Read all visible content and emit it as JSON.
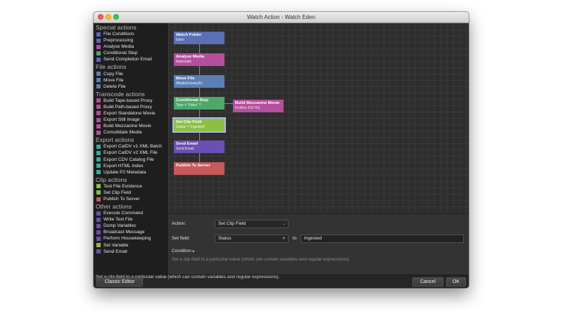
{
  "window": {
    "title": "Watch Action - Watch Eden"
  },
  "sidebar": {
    "sections": [
      {
        "title": "Special actions",
        "items": [
          {
            "label": "File Conditions",
            "color": "#5b67c8"
          },
          {
            "label": "Preprocessing",
            "color": "#5b67c8"
          },
          {
            "label": "Analyse Media",
            "color": "#b44f9e"
          },
          {
            "label": "Conditional Step",
            "color": "#4fa86a"
          },
          {
            "label": "Send Completion Email",
            "color": "#5b67c8"
          }
        ]
      },
      {
        "title": "File actions",
        "items": [
          {
            "label": "Copy File",
            "color": "#5b7fb5"
          },
          {
            "label": "Move File",
            "color": "#5b7fb5"
          },
          {
            "label": "Delete File",
            "color": "#5b7fb5"
          }
        ]
      },
      {
        "title": "Transcode actions",
        "items": [
          {
            "label": "Build Tape-based Proxy",
            "color": "#b44f9e"
          },
          {
            "label": "Build Path-based Proxy",
            "color": "#b44f9e"
          },
          {
            "label": "Export Standalone Movie",
            "color": "#b44f9e"
          },
          {
            "label": "Export Still Image",
            "color": "#b44f9e"
          },
          {
            "label": "Build Mezzanine Movie",
            "color": "#b44f9e"
          },
          {
            "label": "Consolidate Media",
            "color": "#b44f9e"
          }
        ]
      },
      {
        "title": "Export actions",
        "items": [
          {
            "label": "Export CatDV v1 XML Batch",
            "color": "#3fa7a0"
          },
          {
            "label": "Export CatDV v2 XML File",
            "color": "#3fa7a0"
          },
          {
            "label": "Export CDV Catalog File",
            "color": "#3fa7a0"
          },
          {
            "label": "Export HTML Index",
            "color": "#3fa7a0"
          },
          {
            "label": "Update P2 Metadata",
            "color": "#3fa7a0"
          }
        ]
      },
      {
        "title": "Clip actions",
        "items": [
          {
            "label": "Test File Existence",
            "color": "#8dbf45"
          },
          {
            "label": "Set Clip Field",
            "color": "#8dbf45"
          },
          {
            "label": "Publish To Server",
            "color": "#c75a5a"
          }
        ]
      },
      {
        "title": "Other actions",
        "items": [
          {
            "label": "Execute Command",
            "color": "#6a50b0"
          },
          {
            "label": "Write Text File",
            "color": "#6a50b0"
          },
          {
            "label": "Dump Variables",
            "color": "#6a50b0"
          },
          {
            "label": "Broadcast Message",
            "color": "#6a50b0"
          },
          {
            "label": "Perform Housekeeping",
            "color": "#6a50b0"
          },
          {
            "label": "Set Variable",
            "color": "#8dbf45"
          },
          {
            "label": "Send Email",
            "color": "#6a50b0"
          }
        ]
      }
    ]
  },
  "workflow": {
    "nodes": [
      {
        "title": "Watch Folder",
        "subtitle": "Eden",
        "color": "#5b6fb5"
      },
      {
        "title": "Analyse Media",
        "subtitle": "Automatic",
        "color": "#b44f9e"
      },
      {
        "title": "Move File",
        "subtitle": "/Media/Library/Er",
        "color": "#5b7fb5"
      },
      {
        "title": "Conditional Step",
        "subtitle": "Type = 'Video' ?",
        "color": "#4fa86a"
      },
      {
        "title": "Set Clip Field",
        "subtitle": "Status = 'Ingested'",
        "color": "#8dbf45"
      },
      {
        "title": "Send Email",
        "subtitle": "Send Email",
        "color": "#6a50b0"
      },
      {
        "title": "Publish To Server",
        "subtitle": "",
        "color": "#c75a5a"
      }
    ],
    "branch_node": {
      "title": "Build Mezzanine Movie",
      "subtitle": "ProRes 422 HQ",
      "color": "#b44f9e"
    }
  },
  "properties": {
    "action_label": "Action:",
    "action_value": "Set Clip Field",
    "setfield_label": "Set field:",
    "field_value": "Status",
    "to_label": "to",
    "value_text": "Ingested",
    "condition_label": "Condition",
    "condition_chevron": "▸",
    "description": "Set a clip field to a particular value (which can contain variables and regular expressions)."
  },
  "status": {
    "text": "Set a clip field to a particular value (which can contain variables and regular expressions)."
  },
  "buttons": {
    "classic": "Classic Editor",
    "cancel": "Cancel",
    "ok": "OK"
  },
  "icons": {
    "dropdown": "chevron-down-icon",
    "dropdown_glyph": "⌄",
    "field_dropdown_glyph": "▼"
  }
}
